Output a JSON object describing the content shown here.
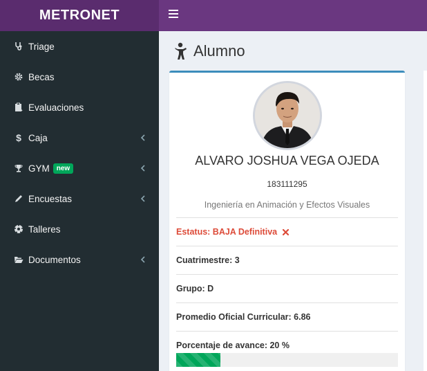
{
  "brand": "METRONET",
  "sidebar": {
    "items": [
      {
        "label": "Triage",
        "icon": "stethoscope-icon"
      },
      {
        "label": "Becas",
        "icon": "gear-icon"
      },
      {
        "label": "Evaluaciones",
        "icon": "clipboard-icon"
      },
      {
        "label": "Caja",
        "icon": "dollar-icon",
        "chevron": true
      },
      {
        "label": "GYM",
        "icon": "trophy-icon",
        "badge": "new",
        "chevron": true
      },
      {
        "label": "Encuestas",
        "icon": "pencil-icon",
        "chevron": true
      },
      {
        "label": "Talleres",
        "icon": "soccer-ball-icon"
      },
      {
        "label": "Documentos",
        "icon": "folder-open-icon",
        "chevron": true
      }
    ]
  },
  "page": {
    "title": "Alumno",
    "icon": "child-icon"
  },
  "student": {
    "name": "ALVARO JOSHUA VEGA OJEDA",
    "id": "183111295",
    "program": "Ingeniería en Animación y Efectos Visuales",
    "status": "Estatus: BAJA Definitiva",
    "cuatrimestre": "Cuatrimestre: 3",
    "grupo": "Grupo: D",
    "promedio": "Promedio Oficial Curricular: 6.86",
    "avance": "Porcentaje de avance: 20 %",
    "progress_percent": 20
  },
  "colors": {
    "brand_bg": "#5a2c6e",
    "topbar_bg": "#6a3780",
    "sidebar_bg": "#222d32",
    "card_top_border": "#3c8dbc",
    "status_red": "#dd4b39",
    "progress_green": "#00a65a",
    "badge_green": "#00a65a"
  }
}
